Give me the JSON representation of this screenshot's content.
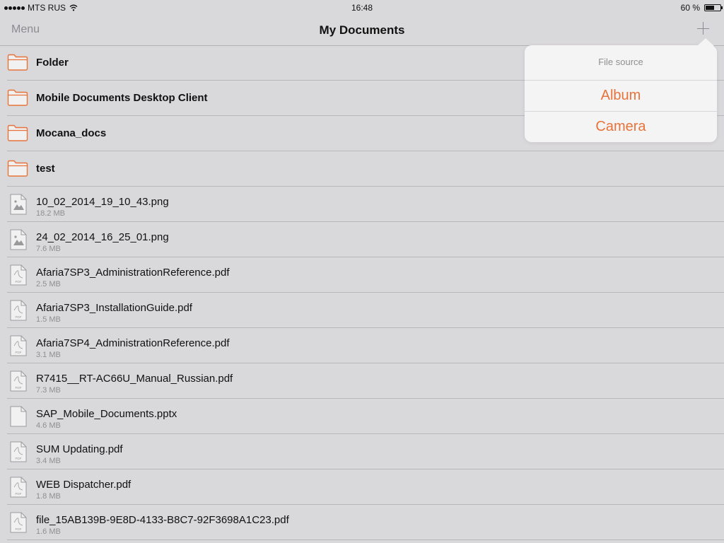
{
  "status_bar": {
    "carrier": "MTS RUS",
    "time": "16:48",
    "battery": "60 %",
    "battery_level": 0.6
  },
  "nav": {
    "menu_label": "Menu",
    "title": "My Documents",
    "add_icon": "plus-icon"
  },
  "list": {
    "folders": [
      {
        "name": "Folder"
      },
      {
        "name": "Mobile Documents Desktop Client"
      },
      {
        "name": "Mocana_docs"
      },
      {
        "name": "test"
      }
    ],
    "files": [
      {
        "name": "10_02_2014_19_10_43.png",
        "size": "18.2 MB",
        "kind": "image"
      },
      {
        "name": "24_02_2014_16_25_01.png",
        "size": "7.6 MB",
        "kind": "image"
      },
      {
        "name": "Afaria7SP3_AdministrationReference.pdf",
        "size": "2.5 MB",
        "kind": "pdf"
      },
      {
        "name": "Afaria7SP3_InstallationGuide.pdf",
        "size": "1.5 MB",
        "kind": "pdf"
      },
      {
        "name": "Afaria7SP4_AdministrationReference.pdf",
        "size": "3.1 MB",
        "kind": "pdf"
      },
      {
        "name": "R7415__RT-AC66U_Manual_Russian.pdf",
        "size": "7.3 MB",
        "kind": "pdf"
      },
      {
        "name": "SAP_Mobile_Documents.pptx",
        "size": "4.6 MB",
        "kind": "generic"
      },
      {
        "name": "SUM Updating.pdf",
        "size": "3.4 MB",
        "kind": "pdf"
      },
      {
        "name": "WEB Dispatcher.pdf",
        "size": "1.8 MB",
        "kind": "pdf"
      },
      {
        "name": "file_15AB139B-9E8D-4133-B8C7-92F3698A1C23.pdf",
        "size": "1.6 MB",
        "kind": "pdf"
      }
    ]
  },
  "popover": {
    "header": "File source",
    "items": [
      {
        "label": "Album"
      },
      {
        "label": "Camera"
      }
    ]
  },
  "colors": {
    "accent": "#e8733a",
    "background": "#d9d8da",
    "popover": "#f4f4f5",
    "folder_icon": "#e8733a"
  }
}
